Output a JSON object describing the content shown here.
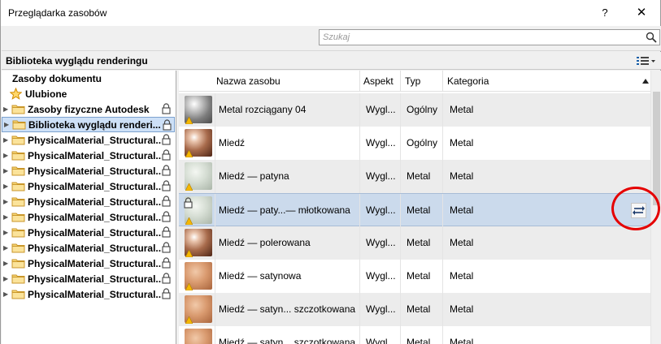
{
  "window": {
    "title": "Przeglądarka zasobów",
    "help_label": "?",
    "close_label": "✕"
  },
  "search": {
    "placeholder": "Szukaj",
    "icon": "search-icon"
  },
  "library_bar": {
    "title": "Biblioteka wyglądu renderingu",
    "view_icon": "list-view-icon"
  },
  "tree": {
    "header": "Zasoby dokumentu",
    "favorites": "Ulubione",
    "items": [
      {
        "label": "Zasoby fizyczne Autodesk",
        "selected": false
      },
      {
        "label": "Biblioteka wyglądu renderi...",
        "selected": true
      },
      {
        "label": "PhysicalMaterial_Structural...",
        "selected": false
      },
      {
        "label": "PhysicalMaterial_Structural...",
        "selected": false
      },
      {
        "label": "PhysicalMaterial_Structural...",
        "selected": false
      },
      {
        "label": "PhysicalMaterial_Structural...",
        "selected": false
      },
      {
        "label": "PhysicalMaterial_Structural...",
        "selected": false
      },
      {
        "label": "PhysicalMaterial_Structural...",
        "selected": false
      },
      {
        "label": "PhysicalMaterial_Structural...",
        "selected": false
      },
      {
        "label": "PhysicalMaterial_Structural...",
        "selected": false
      },
      {
        "label": "PhysicalMaterial_Structural...",
        "selected": false
      },
      {
        "label": "PhysicalMaterial_Structural...",
        "selected": false
      },
      {
        "label": "PhysicalMaterial_Structural...",
        "selected": false
      }
    ]
  },
  "grid": {
    "columns": {
      "name": "Nazwa zasobu",
      "aspect": "Aspekt",
      "type": "Typ",
      "category": "Kategoria"
    },
    "rows": [
      {
        "name": "Metal rozciągany 04",
        "aspect": "Wygl...",
        "type": "Ogólny",
        "category": "Metal",
        "thumb": "steel",
        "style": "alt"
      },
      {
        "name": "Miedź",
        "aspect": "Wygl...",
        "type": "Ogólny",
        "category": "Metal",
        "thumb": "copper",
        "style": "white"
      },
      {
        "name": "Miedź — patyna",
        "aspect": "Wygl...",
        "type": "Metal",
        "category": "Metal",
        "thumb": "patina",
        "style": "alt"
      },
      {
        "name": "Miedź — paty...— młotkowana",
        "aspect": "Wygl...",
        "type": "Metal",
        "category": "Metal",
        "thumb": "patina",
        "style": "selected"
      },
      {
        "name": "Miedź — polerowana",
        "aspect": "Wygl...",
        "type": "Metal",
        "category": "Metal",
        "thumb": "copper",
        "style": "alt"
      },
      {
        "name": "Miedź — satynowa",
        "aspect": "Wygl...",
        "type": "Metal",
        "category": "Metal",
        "thumb": "satin",
        "style": "white"
      },
      {
        "name": "Miedź — satyn... szczotkowana",
        "aspect": "Wygl...",
        "type": "Metal",
        "category": "Metal",
        "thumb": "satin",
        "style": "alt"
      },
      {
        "name": "Miedź — satyn... szczotkowana",
        "aspect": "Wygl...",
        "type": "Metal",
        "category": "Metal",
        "thumb": "satin",
        "style": "white"
      }
    ]
  },
  "colors": {
    "highlight": "#e50000",
    "selection": "#cbdaec"
  }
}
